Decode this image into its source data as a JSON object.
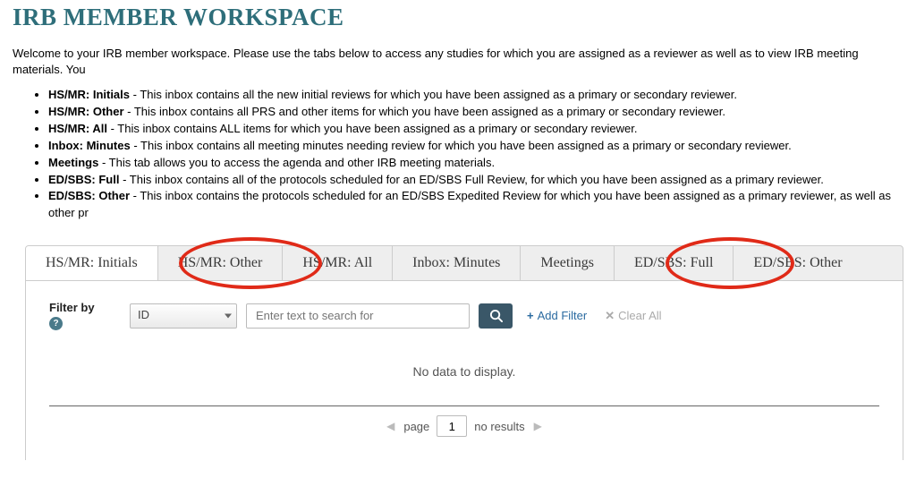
{
  "page_title": "IRB MEMBER WORKSPACE",
  "intro": "Welcome to your IRB member workspace. Please use the tabs below to access any studies for which you are assigned as a reviewer as well as to view IRB meeting materials. You",
  "descriptions": [
    {
      "label": "HS/MR: Initials",
      "text": " - This inbox contains all the new initial reviews for which you have been assigned as a primary or secondary reviewer."
    },
    {
      "label": "HS/MR: Other",
      "text": " - This inbox contains all PRS and other items for which you have been assigned as a primary or secondary reviewer."
    },
    {
      "label": "HS/MR: All",
      "text": " - This inbox contains ALL items for which you have been assigned as a primary or secondary reviewer."
    },
    {
      "label": "Inbox: Minutes",
      "text": " - This inbox contains all meeting minutes needing review for which you have been assigned as a primary or secondary reviewer."
    },
    {
      "label": "Meetings",
      "text": " - This tab allows you to access the agenda and other IRB meeting materials."
    },
    {
      "label": "ED/SBS: Full",
      "text": " - This inbox contains all of the protocols scheduled for an ED/SBS Full Review, for which you have been assigned as a primary reviewer."
    },
    {
      "label": "ED/SBS: Other",
      "text": " - This inbox contains the protocols scheduled for an ED/SBS Expedited Review for which you have been assigned as a primary reviewer, as well as other pr"
    }
  ],
  "tabs": [
    {
      "label": "HS/MR: Initials",
      "active": true
    },
    {
      "label": "HS/MR: Other",
      "active": false
    },
    {
      "label": "HS/MR: All",
      "active": false
    },
    {
      "label": "Inbox: Minutes",
      "active": false
    },
    {
      "label": "Meetings",
      "active": false
    },
    {
      "label": "ED/SBS: Full",
      "active": false
    },
    {
      "label": "ED/SBS: Other",
      "active": false
    }
  ],
  "filter": {
    "label": "Filter by",
    "help_glyph": "?",
    "select_value": "ID",
    "search_placeholder": "Enter text to search for",
    "add_filter_label": "Add Filter",
    "clear_all_label": "Clear All"
  },
  "table": {
    "no_data": "No data to display."
  },
  "pager": {
    "page_label": "page",
    "page_value": "1",
    "results_label": "no results"
  }
}
